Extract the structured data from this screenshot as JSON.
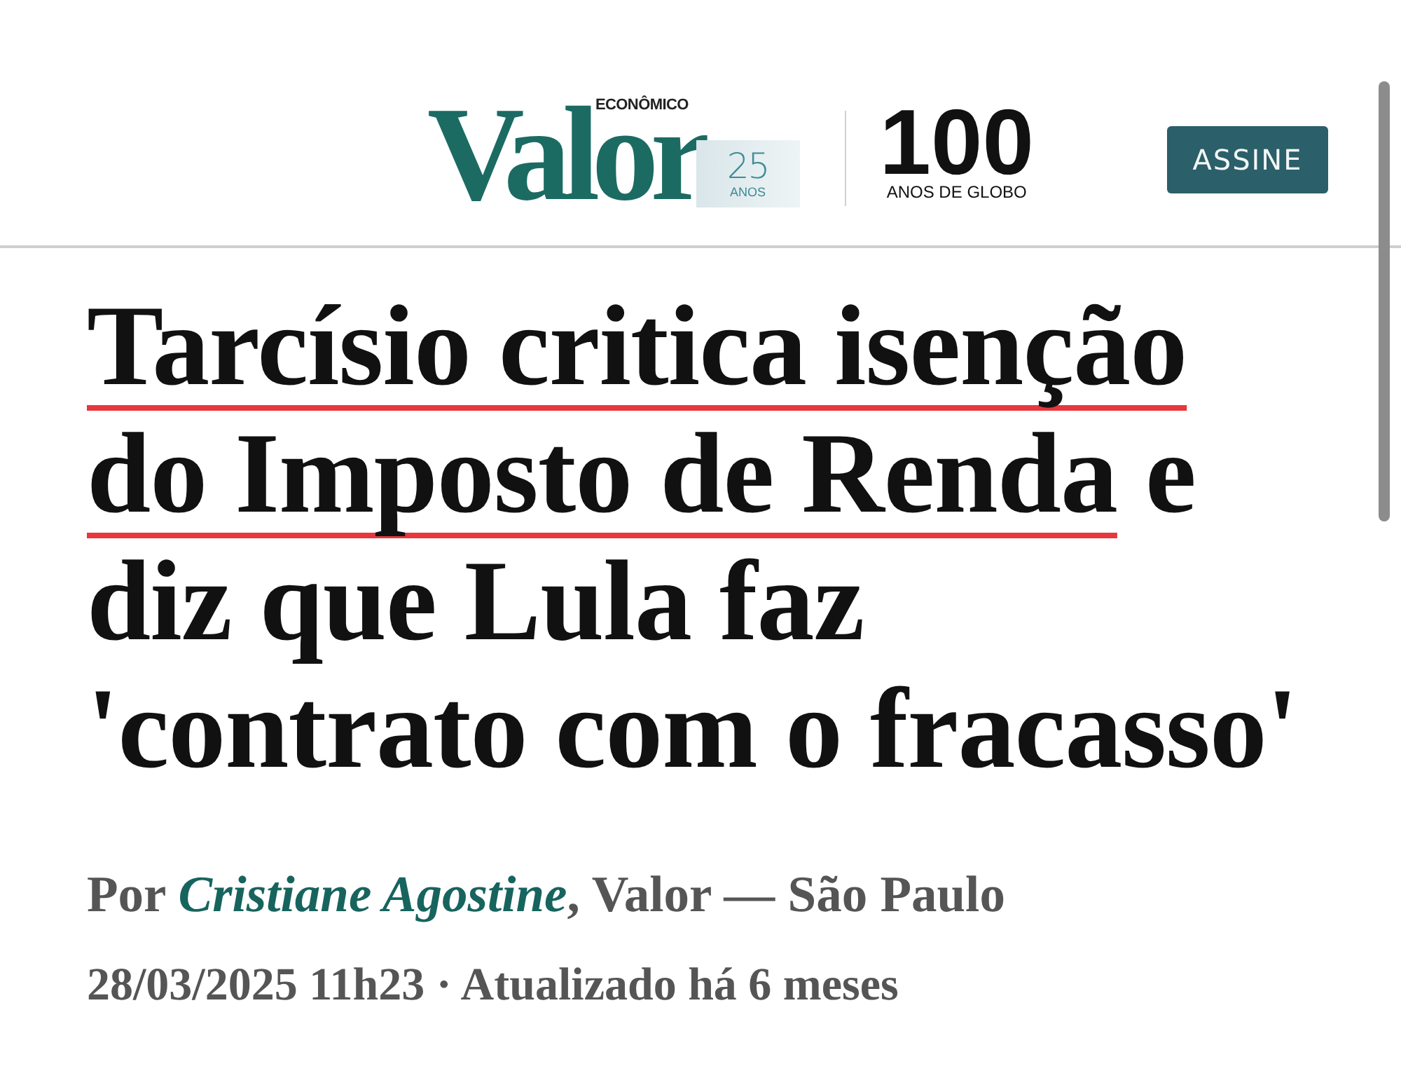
{
  "header": {
    "logo": {
      "name": "Valor",
      "tagline": "ECONÔMICO",
      "anniversary_number": "25",
      "anniversary_label": "ANOS"
    },
    "partner_logo": {
      "number": "100",
      "label": "ANOS DE GLOBO"
    },
    "subscribe_button": "ASSINE"
  },
  "headline": [
    {
      "text": "Tarcísio critica isenção do Imposto de Renda",
      "underlined": true
    },
    {
      "text": "e diz que Lula faz 'contrato com o fracasso'",
      "underlined": false
    }
  ],
  "byline": {
    "prefix": "Por",
    "author": "Cristiane Agostine",
    "suffix": ", Valor — São Paulo"
  },
  "timestamp": "28/03/2025 11h23 · Atualizado há 6 meses"
}
